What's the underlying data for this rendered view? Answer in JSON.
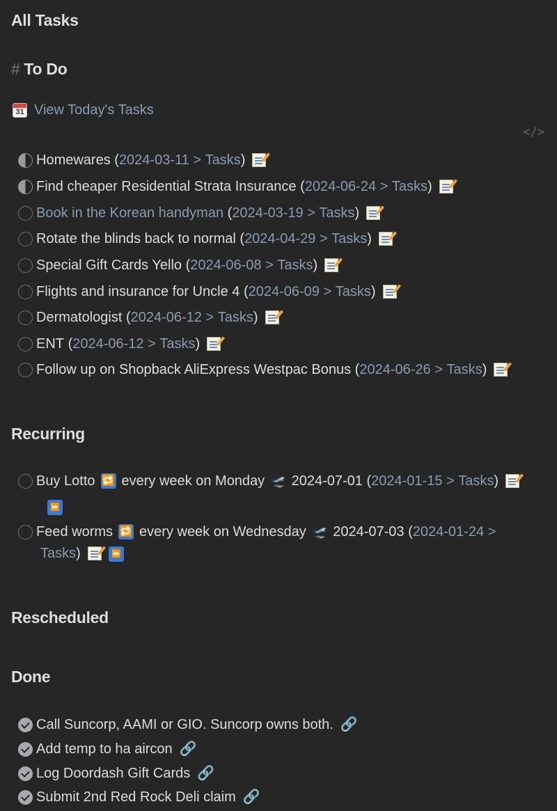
{
  "headings": {
    "all_tasks": "All Tasks",
    "todo_hash": "#",
    "todo": "To Do",
    "recurring": "Recurring",
    "rescheduled": "Rescheduled",
    "done": "Done"
  },
  "today_link": {
    "icon": "calendar-icon",
    "icon_text": "31",
    "label": "View Today's Tasks"
  },
  "code_toggle": "</>",
  "todo_tasks": [
    {
      "text": "Homewares",
      "date": "2024-03-11",
      "sep": " > ",
      "file": "Tasks",
      "state": "in-progress"
    },
    {
      "text": "Find cheaper Residential Strata Insurance",
      "date": "2024-06-24",
      "sep": " > ",
      "file": "Tasks",
      "state": "in-progress"
    },
    {
      "text": "Book in the Korean handyman",
      "date": "2024-03-19",
      "sep": " > ",
      "file": "Tasks",
      "state": "open-link"
    },
    {
      "text": "Rotate the blinds back to normal",
      "date": "2024-04-29",
      "sep": " > ",
      "file": "Tasks",
      "state": "open"
    },
    {
      "text": "Special Gift Cards Yello",
      "date": "2024-06-08",
      "sep": " > ",
      "file": "Tasks",
      "state": "open"
    },
    {
      "text": "Flights and insurance for Uncle 4",
      "date": "2024-06-09",
      "sep": " > ",
      "file": "Tasks",
      "state": "open"
    },
    {
      "text": "Dermatologist",
      "date": "2024-06-12",
      "sep": " > ",
      "file": "Tasks",
      "state": "open"
    },
    {
      "text": "ENT",
      "date": "2024-06-12",
      "sep": " > ",
      "file": "Tasks",
      "state": "open"
    },
    {
      "text": "Follow up on Shopback AliExpress Westpac Bonus",
      "date": "2024-06-26",
      "sep": " > ",
      "file": "Tasks",
      "state": "open"
    }
  ],
  "recurring_tasks": [
    {
      "text": "Buy Lotto",
      "rule": "every week on Monday",
      "due": "2024-07-01",
      "date": "2024-01-15",
      "sep": " > ",
      "file": "Tasks"
    },
    {
      "text": "Feed worms",
      "rule": "every week on Wednesday",
      "due": "2024-07-03",
      "date": "2024-01-24",
      "sep": " >",
      "file": "Tasks"
    }
  ],
  "done_tasks": [
    {
      "text": "Call Suncorp, AAMI or GIO. Suncorp owns both."
    },
    {
      "text": "Add temp to ha aircon"
    },
    {
      "text": "Log Doordash Gift Cards"
    },
    {
      "text": "Submit 2nd Red Rock Deli claim"
    }
  ],
  "glyphs": {
    "open_paren": "(",
    "close_paren": ")",
    "recur": "🔁",
    "due": "🛫",
    "ff": "⏩",
    "chain": "🔗"
  }
}
